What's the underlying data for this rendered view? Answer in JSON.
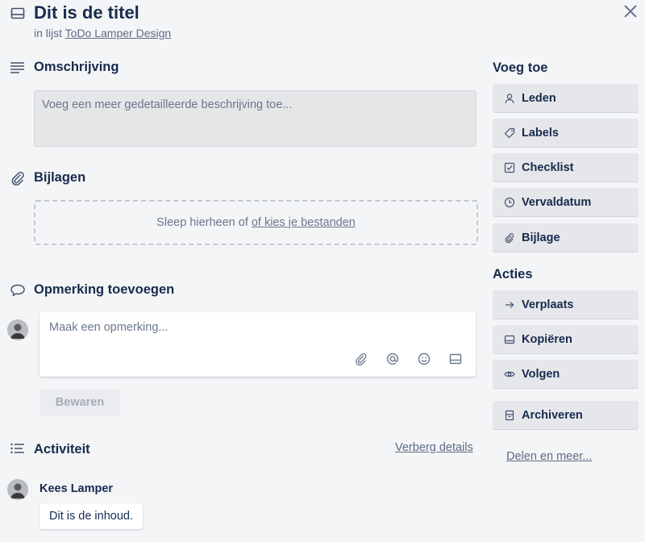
{
  "card": {
    "title": "Dit is de titel",
    "list_prefix": "in lijst",
    "list_name": "ToDo Lamper Design"
  },
  "description": {
    "heading": "Omschrijving",
    "placeholder": "Voeg een meer gedetailleerde beschrijving toe..."
  },
  "attachments": {
    "heading": "Bijlagen",
    "drop_text": "Sleep hierheen of",
    "choose_link": "of kies je bestanden"
  },
  "comment": {
    "heading": "Opmerking toevoegen",
    "placeholder": "Maak een opmerking...",
    "tools": [
      "attachment-icon",
      "mention-icon",
      "emoji-icon",
      "card-icon"
    ],
    "save_label": "Bewaren"
  },
  "activity": {
    "heading": "Activiteit",
    "hide_details": "Verberg details",
    "entries": [
      {
        "author": "Kees Lamper",
        "content": "Dit is de inhoud."
      }
    ]
  },
  "sidebar": {
    "add_heading": "Voeg toe",
    "add_items": [
      {
        "label": "Leden",
        "icon": "person-icon"
      },
      {
        "label": "Labels",
        "icon": "tag-icon"
      },
      {
        "label": "Checklist",
        "icon": "checkbox-icon"
      },
      {
        "label": "Vervaldatum",
        "icon": "clock-icon"
      },
      {
        "label": "Bijlage",
        "icon": "paperclip-icon"
      }
    ],
    "actions_heading": "Acties",
    "action_items": [
      {
        "label": "Verplaats",
        "icon": "arrow-right-icon"
      },
      {
        "label": "Kopiëren",
        "icon": "card-icon"
      },
      {
        "label": "Volgen",
        "icon": "eye-icon"
      },
      {
        "label": "Archiveren",
        "icon": "archive-icon"
      }
    ],
    "share_link": "Delen en meer..."
  }
}
